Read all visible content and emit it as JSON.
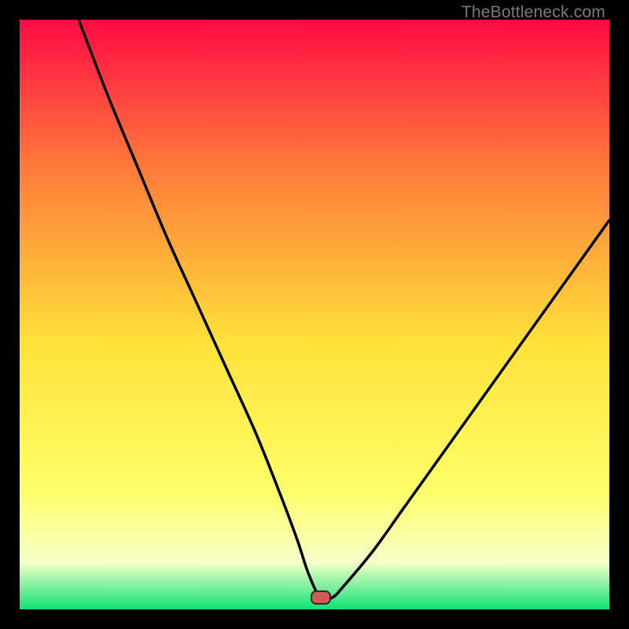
{
  "watermark": "TheBottleneck.com",
  "colors": {
    "bg_border": "#000000",
    "grad_top": "#ff0b45",
    "grad_mid1": "#ff7a3a",
    "grad_mid2": "#ffe23a",
    "grad_mid3": "#ffff6a",
    "grad_low": "#f6ffc8",
    "grad_bottom": "#10e276",
    "curve": "#000000",
    "marker_fill": "#cf5a56",
    "marker_stroke": "#2e2e2e"
  },
  "chart_data": {
    "type": "line",
    "title": "",
    "xlabel": "",
    "ylabel": "",
    "xlim": [
      0,
      100
    ],
    "ylim": [
      0,
      100
    ],
    "legend": false,
    "grid": false,
    "marker": {
      "x": 51,
      "y": 2
    },
    "series": [
      {
        "name": "bottleneck-curve",
        "x": [
          10,
          15,
          20,
          25,
          30,
          35,
          40,
          44,
          47,
          49,
          51,
          53,
          55,
          60,
          65,
          70,
          75,
          80,
          85,
          90,
          95,
          100
        ],
        "y": [
          100,
          87,
          75,
          63,
          52,
          41,
          30,
          20,
          12,
          6,
          2,
          2,
          4,
          10,
          17,
          24,
          31,
          38,
          45,
          52,
          59,
          66
        ]
      }
    ],
    "background_gradient_stops": [
      {
        "offset": 0.0,
        "color": "#ff0b45"
      },
      {
        "offset": 0.25,
        "color": "#ff7a3a"
      },
      {
        "offset": 0.55,
        "color": "#ffe23a"
      },
      {
        "offset": 0.8,
        "color": "#ffff6a"
      },
      {
        "offset": 0.92,
        "color": "#f6ffc8"
      },
      {
        "offset": 1.0,
        "color": "#10e276"
      }
    ]
  }
}
